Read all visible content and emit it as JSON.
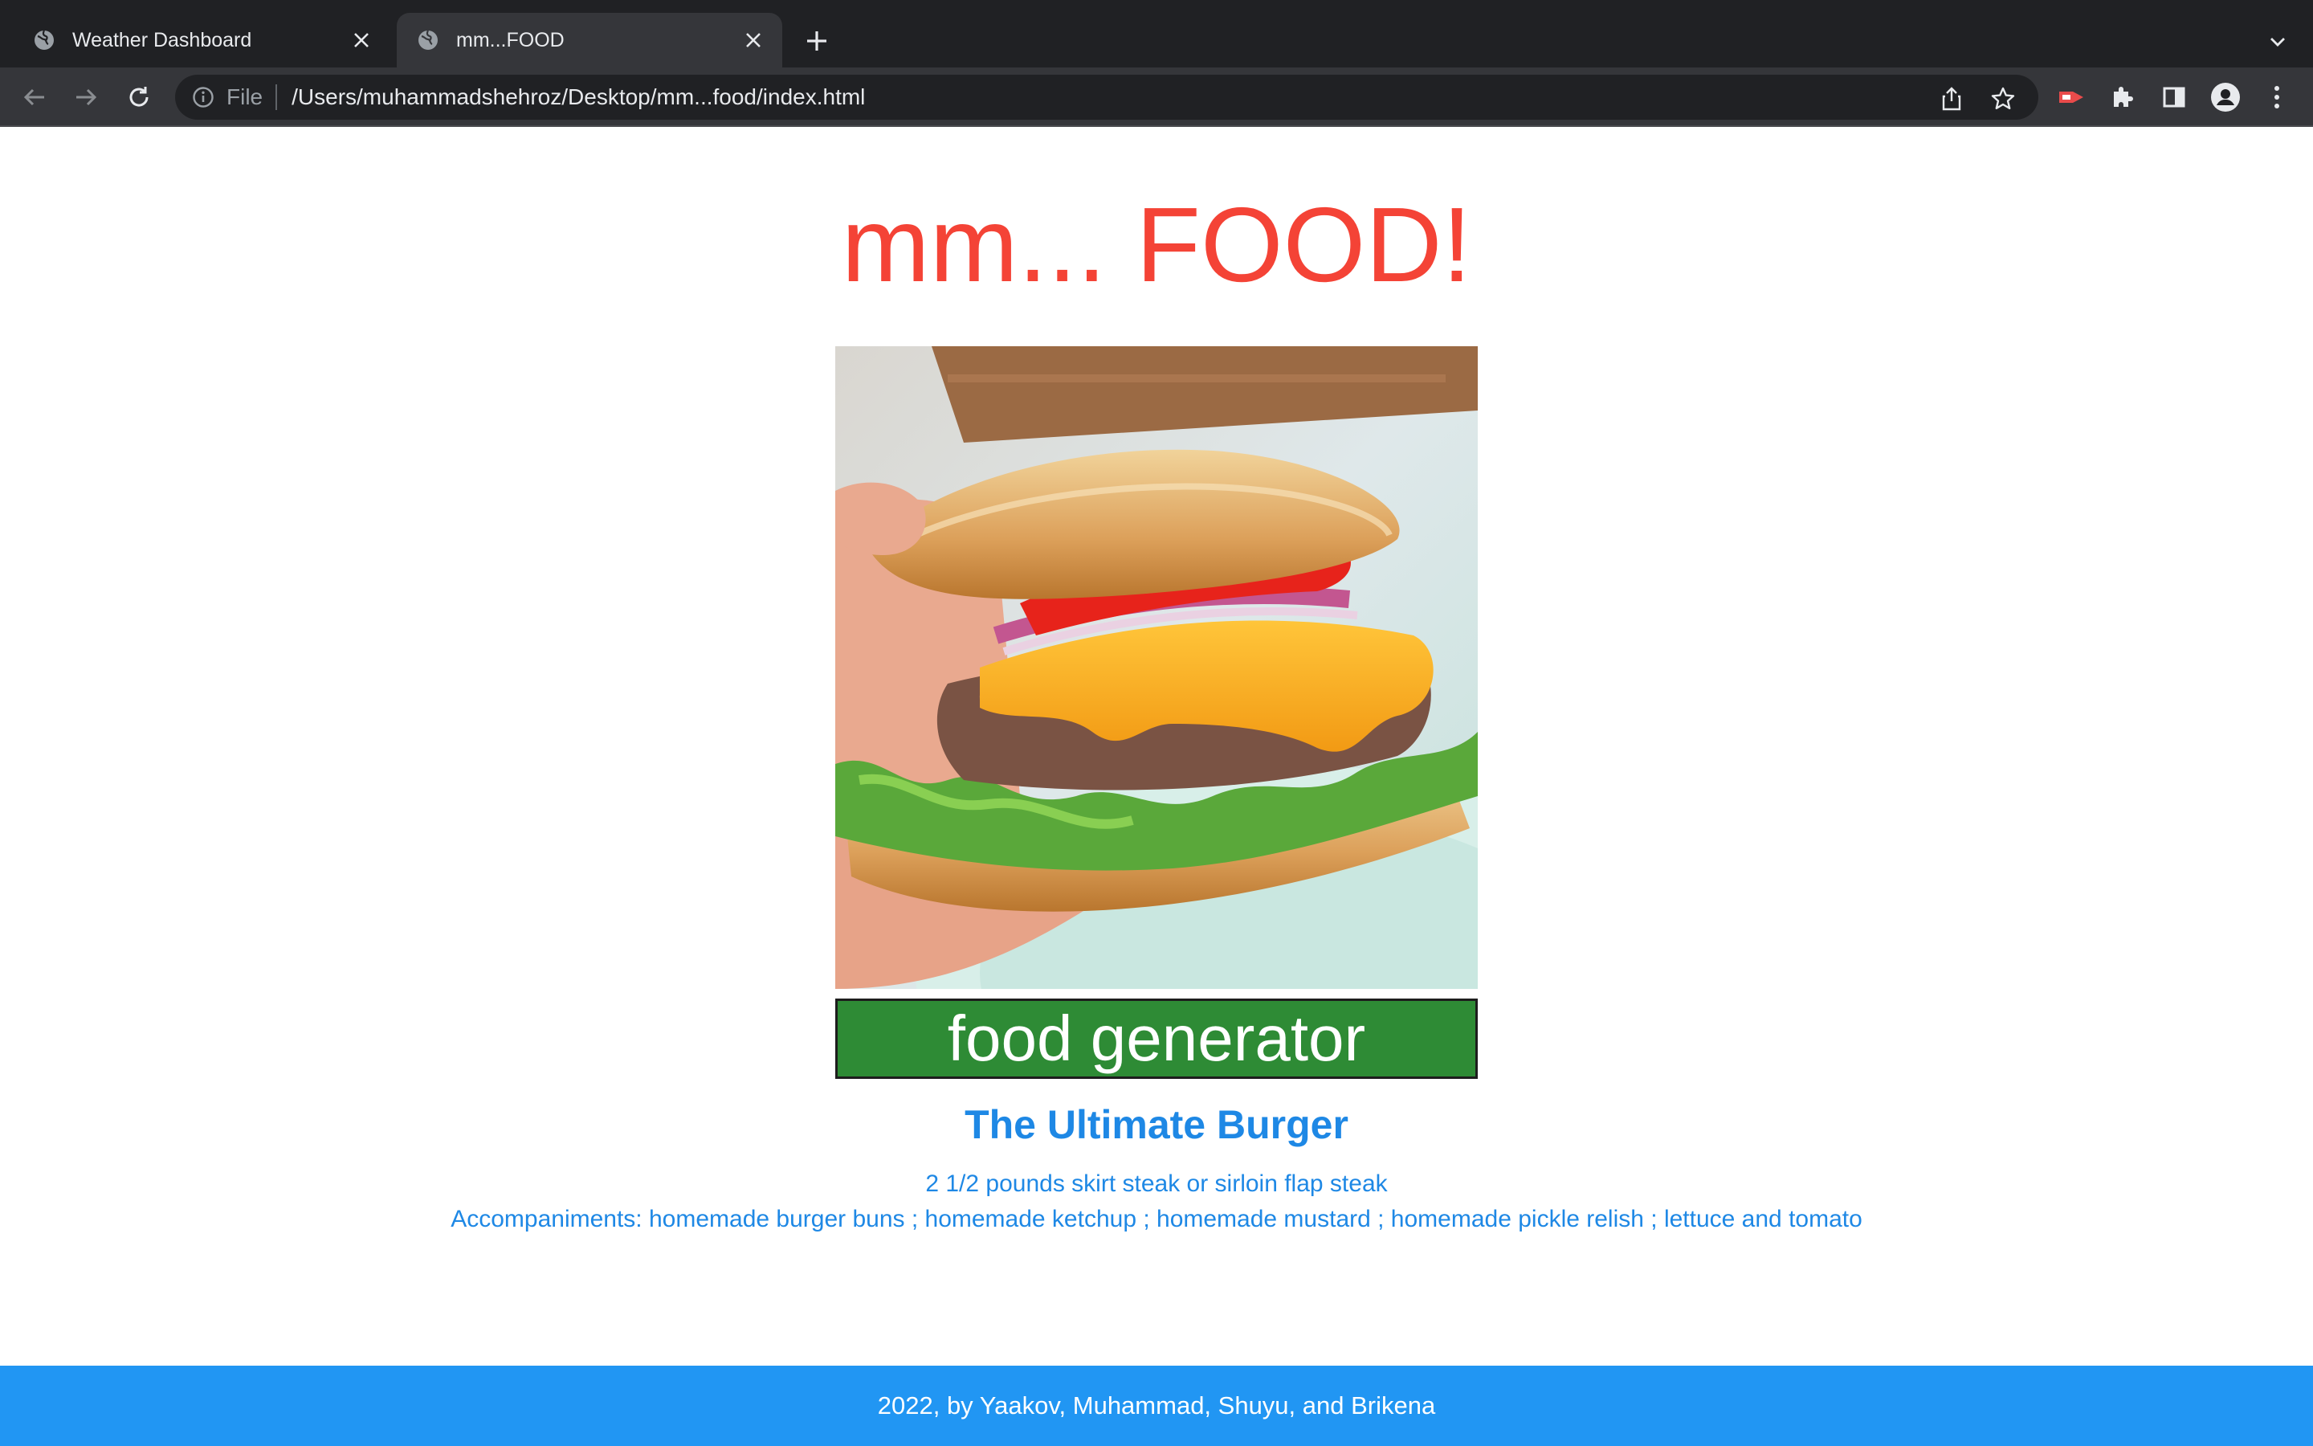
{
  "browser": {
    "tabs": [
      {
        "title": "Weather Dashboard",
        "active": false
      },
      {
        "title": "mm...FOOD",
        "active": true
      }
    ],
    "omnibox": {
      "scheme": "File",
      "url": "/Users/muhammadshehroz/Desktop/mm...food/index.html"
    }
  },
  "page": {
    "heading": "mm... FOOD!",
    "hero_image_alt": "burger-photo",
    "generator_button": "food generator",
    "recipe": {
      "title": "The Ultimate Burger",
      "ingredients": [
        "2 1/2 pounds skirt steak or sirloin flap steak",
        "Accompaniments: homemade burger buns ; homemade ketchup ; homemade mustard ; homemade pickle relish ; lettuce and tomato"
      ]
    },
    "footer": "2022, by Yaakov, Muhammad, Shuyu, and Brikena"
  },
  "colors": {
    "heading": "#f44336",
    "button": "#2e8b35",
    "recipe_text": "#1e88e5",
    "footer_bg": "#2196f3"
  }
}
